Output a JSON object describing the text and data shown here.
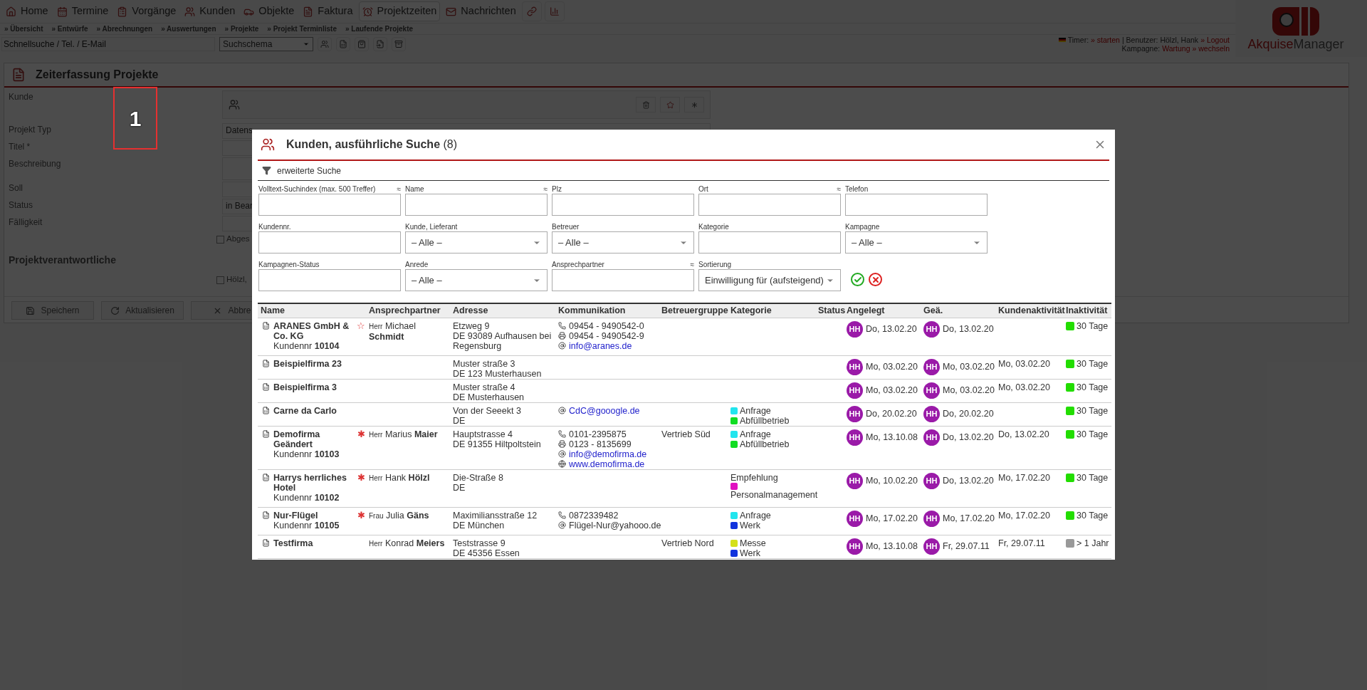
{
  "nav": {
    "items": [
      {
        "label": "Home",
        "selected": false
      },
      {
        "label": "Termine",
        "selected": false
      },
      {
        "label": "Vorgänge",
        "selected": false
      },
      {
        "label": "Kunden",
        "selected": false
      },
      {
        "label": "Objekte",
        "selected": false
      },
      {
        "label": "Faktura",
        "selected": false
      },
      {
        "label": "Projektzeiten",
        "selected": true
      },
      {
        "label": "Nachrichten",
        "selected": false
      }
    ],
    "subnav": [
      "» Übersicht",
      "» Entwürfe",
      "» Abrechnungen",
      "» Auswertungen",
      "» Projekte",
      "» Projekt Terminliste",
      "» Laufende Projekte"
    ],
    "search_placeholder": "Schnellsuche / Tel. / E-Mail",
    "scheme_select": "Suchschema"
  },
  "user_bar": {
    "timer_label": "Timer:",
    "timer_link": "» starten",
    "user_text": "| Benutzer: Hölzl, Hank",
    "logout": "» Logout",
    "campaign_label": "Kampagne:",
    "campaign": "Wartung",
    "change": "» wechseln"
  },
  "logo": {
    "part1": "Akquise",
    "part2": "Manager"
  },
  "panel": {
    "title": "Zeiterfassung Projekte",
    "fields": [
      {
        "label": "Kunde",
        "kind": "customer"
      },
      {
        "label": "Projekt Typ",
        "kind": "select",
        "value": "Datens"
      },
      {
        "label": "Titel *",
        "kind": "text"
      },
      {
        "label": "Beschreibung",
        "kind": "textarea"
      },
      {
        "label": "Soll",
        "kind": "text"
      },
      {
        "label": "Status",
        "kind": "select",
        "value": "in Bear"
      },
      {
        "label": "Fälligkeit",
        "kind": "text"
      }
    ],
    "done_checkbox": {
      "label": "Abges",
      "checked": false
    },
    "section": "Projektverantwortliche",
    "person_checkbox": {
      "label": "Hölzl,",
      "checked": false
    },
    "buttons": [
      "Speichern",
      "Aktualisieren",
      "Abbre"
    ]
  },
  "annotation": {
    "label": "1"
  },
  "modal": {
    "title": "Kunden, ausführliche Suche",
    "count": "(8)",
    "filter_toggle": "erweiterte Suche",
    "filter_rows": [
      [
        {
          "label": "Volltext-Suchindex (max. 500 Treffer)",
          "hint": "≈",
          "kind": "text"
        },
        {
          "label": "Name",
          "hint": "≈",
          "kind": "text"
        },
        {
          "label": "Plz",
          "kind": "text"
        },
        {
          "label": "Ort",
          "hint": "≈",
          "kind": "text"
        },
        {
          "label": "Telefon",
          "kind": "text"
        }
      ],
      [
        {
          "label": "Kundennr.",
          "kind": "text"
        },
        {
          "label": "Kunde, Lieferant",
          "kind": "select",
          "value": "– Alle –"
        },
        {
          "label": "Betreuer",
          "kind": "select",
          "value": "– Alle –"
        },
        {
          "label": "Kategorie",
          "kind": "text"
        },
        {
          "label": "Kampagne",
          "kind": "select",
          "value": "– Alle –"
        }
      ],
      [
        {
          "label": "Kampagnen-Status",
          "kind": "text"
        },
        {
          "label": "Anrede",
          "kind": "select",
          "value": "– Alle –"
        },
        {
          "label": "Ansprechpartner",
          "hint": "≈",
          "kind": "text"
        },
        {
          "label": "Sortierung",
          "kind": "select",
          "value": "Einwilligung für (aufsteigend)"
        }
      ]
    ],
    "table": {
      "columns": [
        "Name",
        "Ansprechpartner",
        "Adresse",
        "Kommunikation",
        "Betreuergruppe",
        "Kategorie",
        "Status",
        "Angelegt",
        "Geä.",
        "Kundenaktivität",
        "Inaktivität"
      ],
      "rows": [
        {
          "name": "ARANES GmbH & Co. KG",
          "customer_no_label": "Kundennr",
          "customer_no": "10104",
          "contact": {
            "marker": "☆",
            "salutation": "Herr",
            "first": "Michael",
            "last": "Schmidt"
          },
          "address": [
            "Etzweg 9",
            "DE 93089 Aufhausen bei Regensburg"
          ],
          "comm": [
            {
              "kind": "phone",
              "text": "09454 - 9490542-0",
              "link": false
            },
            {
              "kind": "fax",
              "text": "09454 - 9490542-9",
              "link": false
            },
            {
              "kind": "email",
              "text": "info@aranes.de",
              "link": true
            }
          ],
          "categories": [],
          "created": {
            "initials": "HH",
            "date": "Do, 13.02.20"
          },
          "changed": {
            "initials": "HH",
            "date": "Do, 13.02.20"
          },
          "inactivity": {
            "color": "#22dd00",
            "text": "30 Tage"
          }
        },
        {
          "name": "Beispielfirma 23",
          "address": [
            "Muster straße 3",
            "DE 123 Musterhausen"
          ],
          "comm": [],
          "categories": [],
          "created": {
            "initials": "HH",
            "date": "Mo, 03.02.20"
          },
          "changed": {
            "initials": "HH",
            "date": "Mo, 03.02.20"
          },
          "activity": "Mo, 03.02.20",
          "inactivity": {
            "color": "#22dd00",
            "text": "30 Tage"
          }
        },
        {
          "name": "Beispielfirma 3",
          "address": [
            "Muster straße 4",
            "DE Musterhausen"
          ],
          "comm": [],
          "categories": [],
          "created": {
            "initials": "HH",
            "date": "Mo, 03.02.20"
          },
          "changed": {
            "initials": "HH",
            "date": "Mo, 03.02.20"
          },
          "activity": "Mo, 03.02.20",
          "inactivity": {
            "color": "#22dd00",
            "text": "30 Tage"
          }
        },
        {
          "name": "Carne da Carlo",
          "address": [
            "Von der Seeekt 3",
            "DE"
          ],
          "comm": [
            {
              "kind": "email",
              "text": "CdC@gooogle.de",
              "link": true
            }
          ],
          "categories": [
            {
              "label": "Anfrage",
              "color": "#22e5ee"
            },
            {
              "label": "Abfüllbetrieb",
              "color": "#11dd22"
            }
          ],
          "created": {
            "initials": "HH",
            "date": "Do, 20.02.20"
          },
          "changed": {
            "initials": "HH",
            "date": "Do, 20.02.20"
          },
          "inactivity": {
            "color": "#22dd00",
            "text": "30 Tage"
          }
        },
        {
          "name": "Demofirma Geändert",
          "customer_no_label": "Kundennr",
          "customer_no": "10103",
          "contact": {
            "marker": "✱",
            "salutation": "Herr",
            "first": "Marius",
            "last": "Maier"
          },
          "address": [
            "Hauptstrasse 4",
            "DE 91355 Hiltpoltstein"
          ],
          "comm": [
            {
              "kind": "phone",
              "text": "0101-2395875",
              "link": false
            },
            {
              "kind": "fax",
              "text": "0123 - 8135699",
              "link": false
            },
            {
              "kind": "email",
              "text": "info@demofirma.de",
              "link": true
            },
            {
              "kind": "web",
              "text": "www.demofirma.de",
              "link": true
            }
          ],
          "group": "Vertrieb Süd",
          "categories": [
            {
              "label": "Anfrage",
              "color": "#22e5ee"
            },
            {
              "label": "Abfüllbetrieb",
              "color": "#11dd22"
            }
          ],
          "created": {
            "initials": "HH",
            "date": "Mo, 13.10.08"
          },
          "changed": {
            "initials": "HH",
            "date": "Do, 13.02.20"
          },
          "activity": "Do, 13.02.20",
          "inactivity": {
            "color": "#22dd00",
            "text": "30 Tage"
          }
        },
        {
          "name": "Harrys herrliches Hotel",
          "customer_no_label": "Kundennr",
          "customer_no": "10102",
          "contact": {
            "marker": "✱",
            "salutation": "Herr",
            "first": "Hank",
            "last": "Hölzl"
          },
          "address": [
            "Die-Straße 8",
            "DE"
          ],
          "comm": [],
          "categories": [
            {
              "label": "Empfehlung"
            },
            {
              "label": "Personalmanagement",
              "color": "#e010c0"
            }
          ],
          "created": {
            "initials": "HH",
            "date": "Mo, 10.02.20"
          },
          "changed": {
            "initials": "HH",
            "date": "Do, 13.02.20"
          },
          "activity": "Mo, 17.02.20",
          "inactivity": {
            "color": "#22dd00",
            "text": "30 Tage"
          }
        },
        {
          "name": "Nur-Flügel",
          "customer_no_label": "Kundennr",
          "customer_no": "10105",
          "contact": {
            "marker": "✱",
            "salutation": "Frau",
            "first": "Julia",
            "last": "Gäns"
          },
          "address": [
            "Maximiliansstraße 12",
            "DE München"
          ],
          "comm": [
            {
              "kind": "phone",
              "text": "0872339482",
              "link": false
            },
            {
              "kind": "email",
              "text": "Flügel-Nur@yahooo.de",
              "link": false
            }
          ],
          "categories": [
            {
              "label": "Anfrage",
              "color": "#22e5ee"
            },
            {
              "label": "Werk",
              "color": "#1133dd"
            }
          ],
          "created": {
            "initials": "HH",
            "date": "Mo, 17.02.20"
          },
          "changed": {
            "initials": "HH",
            "date": "Mo, 17.02.20"
          },
          "activity": "Mo, 17.02.20",
          "inactivity": {
            "color": "#22dd00",
            "text": "30 Tage"
          }
        },
        {
          "name": "Testfirma",
          "contact": {
            "salutation": "Herr",
            "first": "Konrad",
            "last": "Meiers"
          },
          "address": [
            "Teststrasse 9",
            "DE 45356 Essen"
          ],
          "comm": [],
          "group": "Vertrieb Nord",
          "categories": [
            {
              "label": "Messe",
              "color": "#d4e01a"
            },
            {
              "label": "Werk",
              "color": "#1133dd"
            }
          ],
          "created": {
            "initials": "HH",
            "date": "Mo, 13.10.08"
          },
          "changed": {
            "initials": "HH",
            "date": "Fr, 29.07.11"
          },
          "activity": "Fr, 29.07.11",
          "inactivity": {
            "color": "#999999",
            "text": "> 1 Jahr"
          }
        }
      ]
    }
  }
}
